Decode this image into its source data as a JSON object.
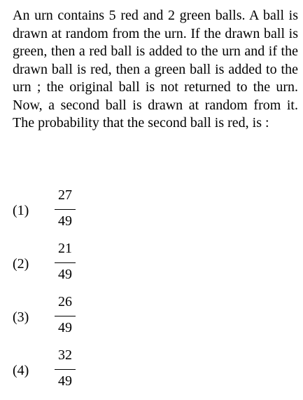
{
  "question": {
    "text": "An urn contains 5 red and 2 green balls. A ball is drawn at random from the urn. If the drawn ball is green, then a red ball is added to the urn and if the drawn ball is red, then a green ball is added to the urn ; the original ball is not returned to the urn. Now, a second ball is drawn at random from it. The probability that the second ball is red, is :"
  },
  "options": [
    {
      "label": "(1)",
      "numerator": "27",
      "denominator": "49"
    },
    {
      "label": "(2)",
      "numerator": "21",
      "denominator": "49"
    },
    {
      "label": "(3)",
      "numerator": "26",
      "denominator": "49"
    },
    {
      "label": "(4)",
      "numerator": "32",
      "denominator": "49"
    }
  ]
}
